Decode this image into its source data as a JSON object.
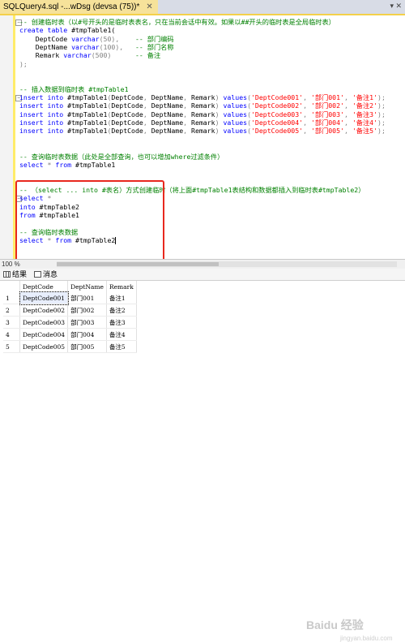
{
  "tab": {
    "title": "SQLQuery4.sql -...wDsg (devsa (75))*",
    "close": "✕"
  },
  "tabbar_right": "▾ ✕",
  "code": [
    [
      {
        "c": "cm",
        "t": "-- 创建临时表（以#号开头的是临时表表名，只在当前会话中有效。如果以##开头的临时表是全局临时表）"
      }
    ],
    [
      {
        "c": "kw",
        "t": "create"
      },
      {
        "c": "",
        "t": " "
      },
      {
        "c": "kw",
        "t": "table"
      },
      {
        "c": "",
        "t": " #tmpTable1("
      }
    ],
    [
      {
        "c": "",
        "t": "    DeptCode "
      },
      {
        "c": "kw",
        "t": "varchar"
      },
      {
        "c": "gy",
        "t": "(50),"
      },
      {
        "c": "",
        "t": "    "
      },
      {
        "c": "cm",
        "t": "-- 部门编码"
      }
    ],
    [
      {
        "c": "",
        "t": "    DeptName "
      },
      {
        "c": "kw",
        "t": "varchar"
      },
      {
        "c": "gy",
        "t": "(100),"
      },
      {
        "c": "",
        "t": "   "
      },
      {
        "c": "cm",
        "t": "-- 部门名称"
      }
    ],
    [
      {
        "c": "",
        "t": "    Remark "
      },
      {
        "c": "kw",
        "t": "varchar"
      },
      {
        "c": "gy",
        "t": "(500)"
      },
      {
        "c": "",
        "t": "      "
      },
      {
        "c": "cm",
        "t": "-- 备注"
      }
    ],
    [
      {
        "c": "gy",
        "t": ");"
      }
    ],
    [],
    [],
    [
      {
        "c": "cm",
        "t": "-- 插入数据到临时表 #tmpTable1"
      }
    ],
    [
      {
        "c": "kw",
        "t": "insert"
      },
      {
        "c": "",
        "t": " "
      },
      {
        "c": "kw",
        "t": "into"
      },
      {
        "c": "",
        "t": " #tmpTable1"
      },
      {
        "c": "gy",
        "t": "("
      },
      {
        "c": "",
        "t": "DeptCode"
      },
      {
        "c": "gy",
        "t": ","
      },
      {
        "c": "",
        "t": " DeptName"
      },
      {
        "c": "gy",
        "t": ","
      },
      {
        "c": "",
        "t": " Remark"
      },
      {
        "c": "gy",
        "t": ")"
      },
      {
        "c": "",
        "t": " "
      },
      {
        "c": "kw",
        "t": "values"
      },
      {
        "c": "gy",
        "t": "("
      },
      {
        "c": "str",
        "t": "'DeptCode001'"
      },
      {
        "c": "gy",
        "t": ", "
      },
      {
        "c": "str",
        "t": "'部门001'"
      },
      {
        "c": "gy",
        "t": ", "
      },
      {
        "c": "str",
        "t": "'备注1'"
      },
      {
        "c": "gy",
        "t": ");"
      }
    ],
    [
      {
        "c": "kw",
        "t": "insert"
      },
      {
        "c": "",
        "t": " "
      },
      {
        "c": "kw",
        "t": "into"
      },
      {
        "c": "",
        "t": " #tmpTable1"
      },
      {
        "c": "gy",
        "t": "("
      },
      {
        "c": "",
        "t": "DeptCode"
      },
      {
        "c": "gy",
        "t": ","
      },
      {
        "c": "",
        "t": " DeptName"
      },
      {
        "c": "gy",
        "t": ","
      },
      {
        "c": "",
        "t": " Remark"
      },
      {
        "c": "gy",
        "t": ")"
      },
      {
        "c": "",
        "t": " "
      },
      {
        "c": "kw",
        "t": "values"
      },
      {
        "c": "gy",
        "t": "("
      },
      {
        "c": "str",
        "t": "'DeptCode002'"
      },
      {
        "c": "gy",
        "t": ", "
      },
      {
        "c": "str",
        "t": "'部门002'"
      },
      {
        "c": "gy",
        "t": ", "
      },
      {
        "c": "str",
        "t": "'备注2'"
      },
      {
        "c": "gy",
        "t": ");"
      }
    ],
    [
      {
        "c": "kw",
        "t": "insert"
      },
      {
        "c": "",
        "t": " "
      },
      {
        "c": "kw",
        "t": "into"
      },
      {
        "c": "",
        "t": " #tmpTable1"
      },
      {
        "c": "gy",
        "t": "("
      },
      {
        "c": "",
        "t": "DeptCode"
      },
      {
        "c": "gy",
        "t": ","
      },
      {
        "c": "",
        "t": " DeptName"
      },
      {
        "c": "gy",
        "t": ","
      },
      {
        "c": "",
        "t": " Remark"
      },
      {
        "c": "gy",
        "t": ")"
      },
      {
        "c": "",
        "t": " "
      },
      {
        "c": "kw",
        "t": "values"
      },
      {
        "c": "gy",
        "t": "("
      },
      {
        "c": "str",
        "t": "'DeptCode003'"
      },
      {
        "c": "gy",
        "t": ", "
      },
      {
        "c": "str",
        "t": "'部门003'"
      },
      {
        "c": "gy",
        "t": ", "
      },
      {
        "c": "str",
        "t": "'备注3'"
      },
      {
        "c": "gy",
        "t": ");"
      }
    ],
    [
      {
        "c": "kw",
        "t": "insert"
      },
      {
        "c": "",
        "t": " "
      },
      {
        "c": "kw",
        "t": "into"
      },
      {
        "c": "",
        "t": " #tmpTable1"
      },
      {
        "c": "gy",
        "t": "("
      },
      {
        "c": "",
        "t": "DeptCode"
      },
      {
        "c": "gy",
        "t": ","
      },
      {
        "c": "",
        "t": " DeptName"
      },
      {
        "c": "gy",
        "t": ","
      },
      {
        "c": "",
        "t": " Remark"
      },
      {
        "c": "gy",
        "t": ")"
      },
      {
        "c": "",
        "t": " "
      },
      {
        "c": "kw",
        "t": "values"
      },
      {
        "c": "gy",
        "t": "("
      },
      {
        "c": "str",
        "t": "'DeptCode004'"
      },
      {
        "c": "gy",
        "t": ", "
      },
      {
        "c": "str",
        "t": "'部门004'"
      },
      {
        "c": "gy",
        "t": ", "
      },
      {
        "c": "str",
        "t": "'备注4'"
      },
      {
        "c": "gy",
        "t": ");"
      }
    ],
    [
      {
        "c": "kw",
        "t": "insert"
      },
      {
        "c": "",
        "t": " "
      },
      {
        "c": "kw",
        "t": "into"
      },
      {
        "c": "",
        "t": " #tmpTable1"
      },
      {
        "c": "gy",
        "t": "("
      },
      {
        "c": "",
        "t": "DeptCode"
      },
      {
        "c": "gy",
        "t": ","
      },
      {
        "c": "",
        "t": " DeptName"
      },
      {
        "c": "gy",
        "t": ","
      },
      {
        "c": "",
        "t": " Remark"
      },
      {
        "c": "gy",
        "t": ")"
      },
      {
        "c": "",
        "t": " "
      },
      {
        "c": "kw",
        "t": "values"
      },
      {
        "c": "gy",
        "t": "("
      },
      {
        "c": "str",
        "t": "'DeptCode005'"
      },
      {
        "c": "gy",
        "t": ", "
      },
      {
        "c": "str",
        "t": "'部门005'"
      },
      {
        "c": "gy",
        "t": ", "
      },
      {
        "c": "str",
        "t": "'备注5'"
      },
      {
        "c": "gy",
        "t": ");"
      }
    ],
    [],
    [],
    [
      {
        "c": "cm",
        "t": "-- 查询临时表数据（此处是全部查询，也可以增加where过滤条件）"
      }
    ],
    [
      {
        "c": "kw",
        "t": "select"
      },
      {
        "c": "",
        "t": " "
      },
      {
        "c": "gy",
        "t": "*"
      },
      {
        "c": "",
        "t": " "
      },
      {
        "c": "kw",
        "t": "from"
      },
      {
        "c": "",
        "t": " #tmpTable1"
      }
    ],
    [],
    [],
    [
      {
        "c": "cm",
        "t": "-- （select ... into #表名）方式创建临时（将上面#tmpTable1表结构和数据都插入到临时表#tmpTable2）"
      }
    ],
    [
      {
        "c": "kw",
        "t": "select"
      },
      {
        "c": "",
        "t": " "
      },
      {
        "c": "gy",
        "t": "*"
      }
    ],
    [
      {
        "c": "kw",
        "t": "into"
      },
      {
        "c": "",
        "t": " #tmpTable2"
      }
    ],
    [
      {
        "c": "kw",
        "t": "from"
      },
      {
        "c": "",
        "t": " #tmpTable1"
      }
    ],
    [],
    [
      {
        "c": "cm",
        "t": "-- 查询临时表数据"
      }
    ],
    [
      {
        "c": "kw",
        "t": "select"
      },
      {
        "c": "",
        "t": " "
      },
      {
        "c": "gy",
        "t": "*"
      },
      {
        "c": "",
        "t": " "
      },
      {
        "c": "kw",
        "t": "from"
      },
      {
        "c": "",
        "t": " #tmpTable2"
      }
    ]
  ],
  "status": {
    "zoom": "100 %"
  },
  "results_tabs": [
    {
      "label": "结果",
      "icon": "grid-icon"
    },
    {
      "label": "消息",
      "icon": "message-icon"
    }
  ],
  "results": {
    "columns": [
      "DeptCode",
      "DeptName",
      "Remark"
    ],
    "rows": [
      {
        "n": "1",
        "cells": [
          "DeptCode001",
          "部门001",
          "备注1"
        ]
      },
      {
        "n": "2",
        "cells": [
          "DeptCode002",
          "部门002",
          "备注2"
        ]
      },
      {
        "n": "3",
        "cells": [
          "DeptCode003",
          "部门003",
          "备注3"
        ]
      },
      {
        "n": "4",
        "cells": [
          "DeptCode004",
          "部门004",
          "备注4"
        ]
      },
      {
        "n": "5",
        "cells": [
          "DeptCode005",
          "部门005",
          "备注5"
        ]
      }
    ]
  },
  "watermark": {
    "text": "Baidu 经验",
    "sub": "jingyan.baidu.com"
  },
  "colors": {
    "keyword": "#0000ff",
    "comment": "#008000",
    "string": "#ff0000",
    "annotation_box": "#e8281e",
    "tab_active": "#f6e29a"
  }
}
